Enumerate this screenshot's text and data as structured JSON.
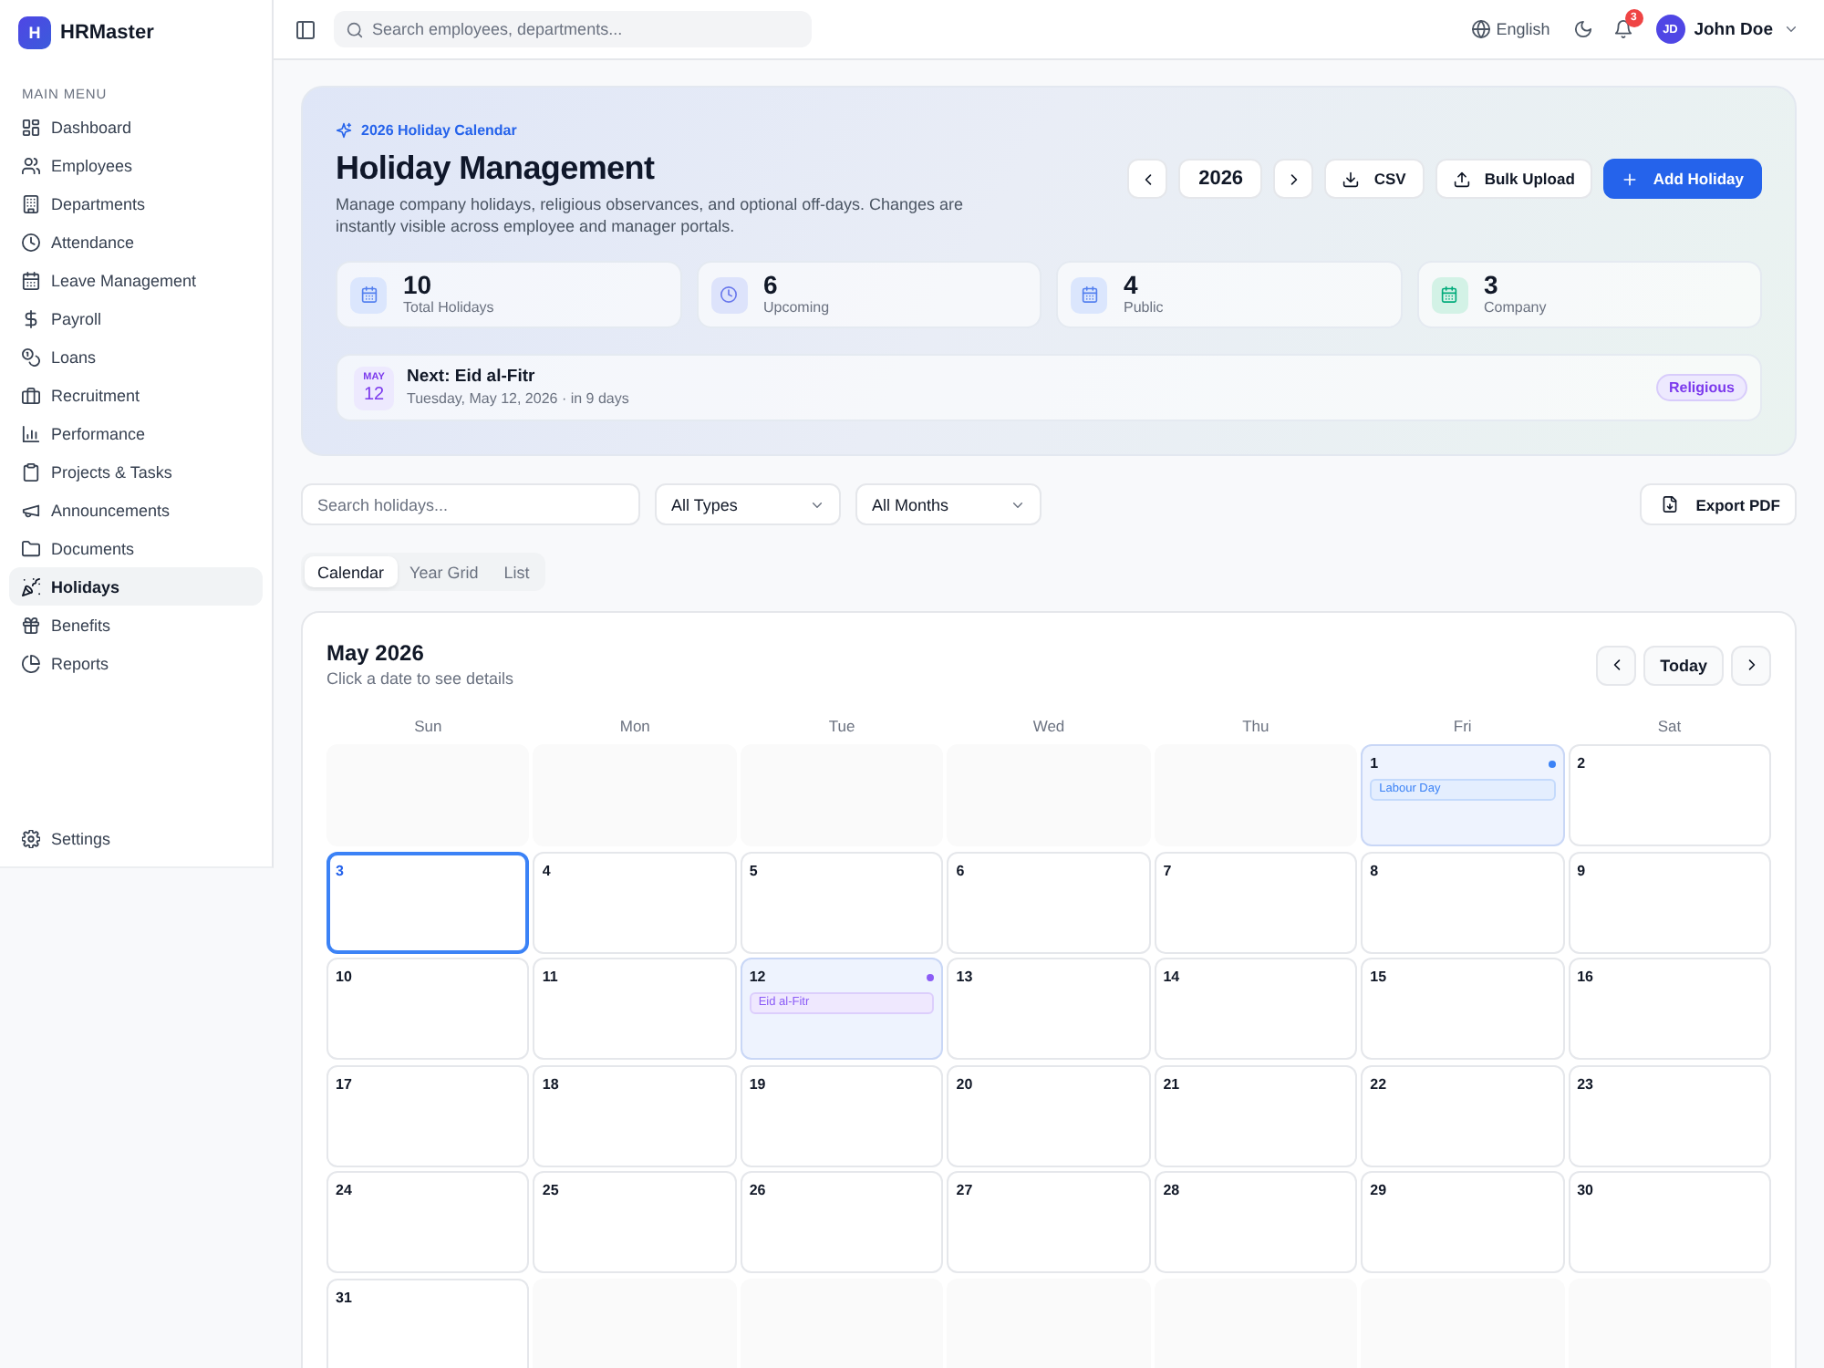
{
  "sidebar": {
    "brand": {
      "logo": "H",
      "name": "HRMaster"
    },
    "section_label": "MAIN MENU",
    "items": [
      {
        "label": "Dashboard",
        "selected": false
      },
      {
        "label": "Employees",
        "selected": false
      },
      {
        "label": "Departments",
        "selected": false
      },
      {
        "label": "Attendance",
        "selected": false
      },
      {
        "label": "Leave Management",
        "selected": false
      },
      {
        "label": "Payroll",
        "selected": false
      },
      {
        "label": "Loans",
        "selected": false
      },
      {
        "label": "Recruitment",
        "selected": false
      },
      {
        "label": "Performance",
        "selected": false
      },
      {
        "label": "Projects & Tasks",
        "selected": false
      },
      {
        "label": "Announcements",
        "selected": false
      },
      {
        "label": "Documents",
        "selected": false
      },
      {
        "label": "Holidays",
        "selected": true
      },
      {
        "label": "Benefits",
        "selected": false
      },
      {
        "label": "Reports",
        "selected": false
      }
    ],
    "footer_item": {
      "label": "Settings"
    }
  },
  "topbar": {
    "search": {
      "placeholder": "Search employees, departments..."
    },
    "language": "English",
    "notifications": {
      "count": "3"
    },
    "user": {
      "initials": "JD",
      "name": "John Doe"
    }
  },
  "header": {
    "eyebrow": "2026 Holiday Calendar",
    "title": "Holiday Management",
    "description": "Manage company holidays, religious observances, and optional off-days. Changes are instantly visible across employee and manager portals.",
    "year": "2026",
    "buttons": [
      {
        "label": "CSV",
        "kind": "secondary"
      },
      {
        "label": "Bulk Upload",
        "kind": "secondary"
      },
      {
        "label": "Add Holiday",
        "kind": "primary"
      }
    ],
    "stats": [
      {
        "value": "10",
        "label": "Total Holidays",
        "color": "#dbe6fd"
      },
      {
        "value": "6",
        "label": "Upcoming",
        "color": "#dde3fb"
      },
      {
        "value": "4",
        "label": "Public",
        "color": "#dbe6fd"
      },
      {
        "value": "3",
        "label": "Company",
        "color": "#d3f2e6"
      }
    ],
    "next_holiday": {
      "month": "MAY",
      "day": "12",
      "title": "Next: Eid al-Fitr",
      "subtitle": "Tuesday, May 12, 2026 · in 9 days",
      "badge": "Religious"
    }
  },
  "filters": {
    "search": {
      "placeholder": "Search holidays..."
    },
    "selects": [
      {
        "value": "All Types"
      },
      {
        "value": "All Months"
      }
    ],
    "export_button": "Export PDF"
  },
  "tabs": [
    {
      "label": "Calendar",
      "selected": true
    },
    {
      "label": "Year Grid",
      "selected": false
    },
    {
      "label": "List",
      "selected": false
    }
  ],
  "calendar": {
    "title": "May 2026",
    "subtitle": "Click a date to see details",
    "today_button": "Today",
    "weekdays": [
      "Sun",
      "Mon",
      "Tue",
      "Wed",
      "Thu",
      "Fri",
      "Sat"
    ],
    "weeks": [
      [
        {
          "kind": "blank"
        },
        {
          "kind": "blank"
        },
        {
          "kind": "blank"
        },
        {
          "kind": "blank"
        },
        {
          "kind": "blank"
        },
        {
          "kind": "day",
          "day": "1",
          "today": false,
          "events": [
            {
              "label": "Labour Day",
              "color": "#3b82f6"
            }
          ]
        },
        {
          "kind": "day",
          "day": "2",
          "today": false
        }
      ],
      [
        {
          "kind": "day",
          "day": "3",
          "today": true
        },
        {
          "kind": "day",
          "day": "4",
          "today": false
        },
        {
          "kind": "day",
          "day": "5",
          "today": false
        },
        {
          "kind": "day",
          "day": "6",
          "today": false
        },
        {
          "kind": "day",
          "day": "7",
          "today": false
        },
        {
          "kind": "day",
          "day": "8",
          "today": false
        },
        {
          "kind": "day",
          "day": "9",
          "today": false
        }
      ],
      [
        {
          "kind": "day",
          "day": "10",
          "today": false
        },
        {
          "kind": "day",
          "day": "11",
          "today": false
        },
        {
          "kind": "day",
          "day": "12",
          "today": false,
          "events": [
            {
              "label": "Eid al-Fitr",
              "color": "#8b5cf6"
            }
          ]
        },
        {
          "kind": "day",
          "day": "13",
          "today": false
        },
        {
          "kind": "day",
          "day": "14",
          "today": false
        },
        {
          "kind": "day",
          "day": "15",
          "today": false
        },
        {
          "kind": "day",
          "day": "16",
          "today": false
        }
      ],
      [
        {
          "kind": "day",
          "day": "17",
          "today": false
        },
        {
          "kind": "day",
          "day": "18",
          "today": false
        },
        {
          "kind": "day",
          "day": "19",
          "today": false
        },
        {
          "kind": "day",
          "day": "20",
          "today": false
        },
        {
          "kind": "day",
          "day": "21",
          "today": false
        },
        {
          "kind": "day",
          "day": "22",
          "today": false
        },
        {
          "kind": "day",
          "day": "23",
          "today": false
        }
      ],
      [
        {
          "kind": "day",
          "day": "24",
          "today": false
        },
        {
          "kind": "day",
          "day": "25",
          "today": false
        },
        {
          "kind": "day",
          "day": "26",
          "today": false
        },
        {
          "kind": "day",
          "day": "27",
          "today": false
        },
        {
          "kind": "day",
          "day": "28",
          "today": false
        },
        {
          "kind": "day",
          "day": "29",
          "today": false
        },
        {
          "kind": "day",
          "day": "30",
          "today": false
        }
      ],
      [
        {
          "kind": "day",
          "day": "31",
          "today": false
        },
        {
          "kind": "blank"
        },
        {
          "kind": "blank"
        },
        {
          "kind": "blank"
        },
        {
          "kind": "blank"
        },
        {
          "kind": "blank"
        },
        {
          "kind": "blank"
        }
      ]
    ]
  }
}
